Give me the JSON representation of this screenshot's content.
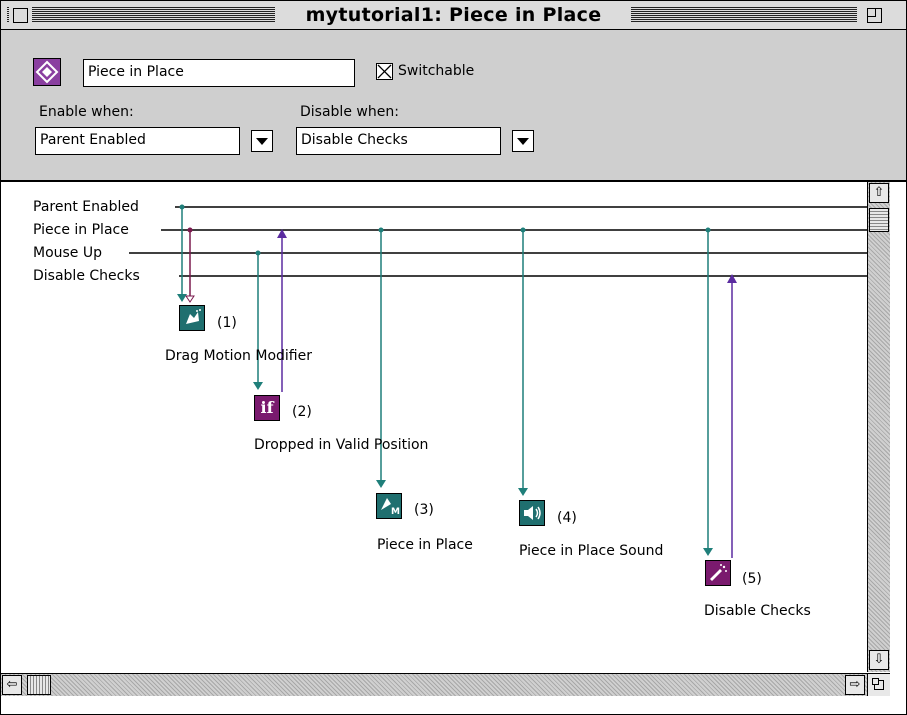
{
  "window": {
    "title": "mytutorial1: Piece in Place"
  },
  "header": {
    "name_value": "Piece in Place",
    "switchable_label": "Switchable",
    "switchable_checked": true,
    "enable_label": "Enable when:",
    "disable_label": "Disable when:",
    "enable_value": "Parent Enabled",
    "disable_value": "Disable Checks"
  },
  "messages": [
    "Parent Enabled",
    "Piece in Place",
    "Mouse Up",
    "Disable Checks"
  ],
  "nodes": [
    {
      "num": "(1)",
      "label": "Drag Motion Modifier",
      "icon": "drag-motion-icon",
      "color": "#1f6f6f"
    },
    {
      "num": "(2)",
      "label": "Dropped in Valid Position",
      "icon": "if-icon",
      "color": "#7a1a6e"
    },
    {
      "num": "(3)",
      "label": "Piece in Place",
      "icon": "messenger-icon",
      "color": "#1f6f6f"
    },
    {
      "num": "(4)",
      "label": "Piece in Place Sound",
      "icon": "sound-icon",
      "color": "#1f6f6f"
    },
    {
      "num": "(5)",
      "label": "Disable Checks",
      "icon": "broadcast-icon",
      "color": "#7a1a6e"
    }
  ],
  "colors": {
    "teal": "#1f7f7a",
    "purple": "#5b2ca0",
    "maroon": "#7a1a4e",
    "panel": "#cfcfcf"
  },
  "icons": {
    "if_glyph": "if",
    "up_arrow": "⇧",
    "down_arrow": "⇩",
    "left_arrow": "⇦",
    "right_arrow": "⇨"
  }
}
